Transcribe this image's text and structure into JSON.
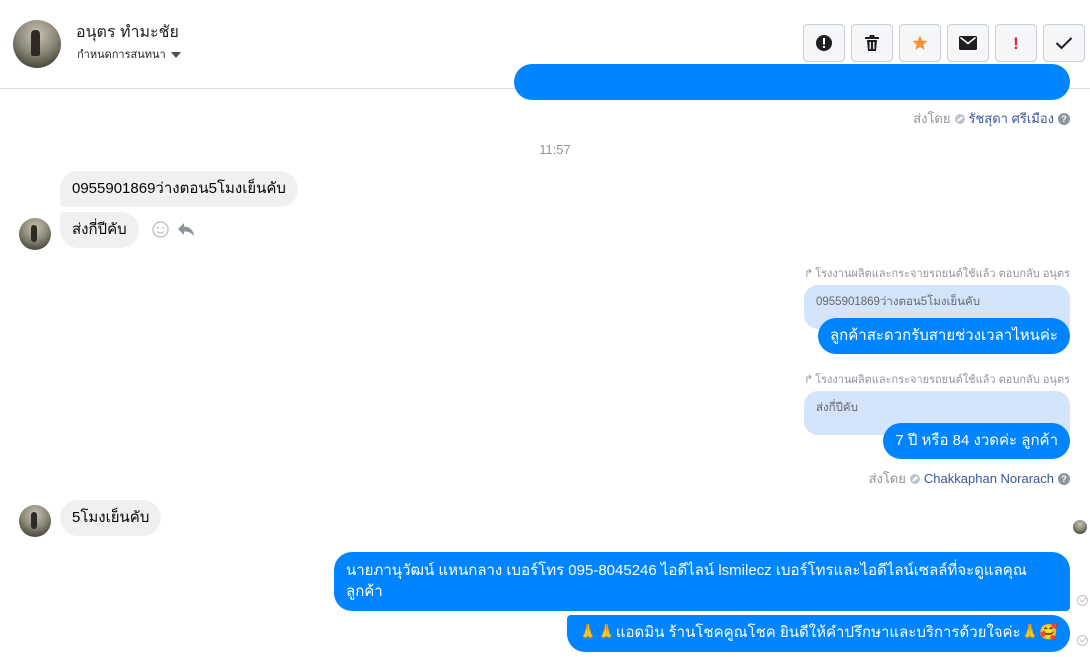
{
  "header": {
    "contact_name": "อนุตร ทำมะชัย",
    "subtitle": "กำหนดการสนทนา",
    "actions": [
      {
        "name": "report-icon",
        "label": "!"
      },
      {
        "name": "trash-icon"
      },
      {
        "name": "star-icon",
        "color": "#f7923b"
      },
      {
        "name": "mail-icon"
      },
      {
        "name": "important-icon",
        "label": "!",
        "color": "#e41e3f"
      },
      {
        "name": "check-icon"
      }
    ]
  },
  "chat": {
    "sent_by_1": {
      "prefix": "ส่งโดย",
      "name": "รัชสุดา ศรีเมือง"
    },
    "timestamp": "11:57",
    "incoming_1": "0955901869ว่างตอน5โมงเย็นคับ",
    "incoming_2": "ส่งกี่ปีคับ",
    "reply_1": {
      "note": "โรงงานผลิตและกระจายรถยนต์ใช้แล้ว ตอบกลับ อนุตร",
      "quote": "0955901869ว่างตอน5โมงเย็นคับ",
      "text": "ลูกค้าสะดวกรับสายช่วงเวลาไหนค่ะ"
    },
    "reply_2": {
      "note": "โรงงานผลิตและกระจายรถยนต์ใช้แล้ว ตอบกลับ อนุตร",
      "quote": "ส่งกี่ปีคับ",
      "text": "7 ปี หรือ 84 งวดค่ะ ลูกค้า"
    },
    "sent_by_2": {
      "prefix": "ส่งโดย",
      "name": "Chakkaphan Norarach"
    },
    "incoming_3": "5โมงเย็นคับ",
    "outgoing_1": "นายภานุวัฒน์ แหนกลาง เบอร์โทร 095-8045246 ไอดีไลน์ lsmilecz   เบอร์โทรและไอดีไลน์เซลล์ที่จะดูแลคุณลูกค้า",
    "outgoing_2": "🙏🙏แอดมิน ร้านโชคคูณโชค ยินดีให้คำปรึกษาและบริการด้วยใจค่ะ🙏🥰"
  },
  "colors": {
    "outgoing_bubble": "#0084ff",
    "incoming_bubble": "#f1f0f0",
    "quote_bubble": "#d3e4fb",
    "link": "#385898"
  }
}
